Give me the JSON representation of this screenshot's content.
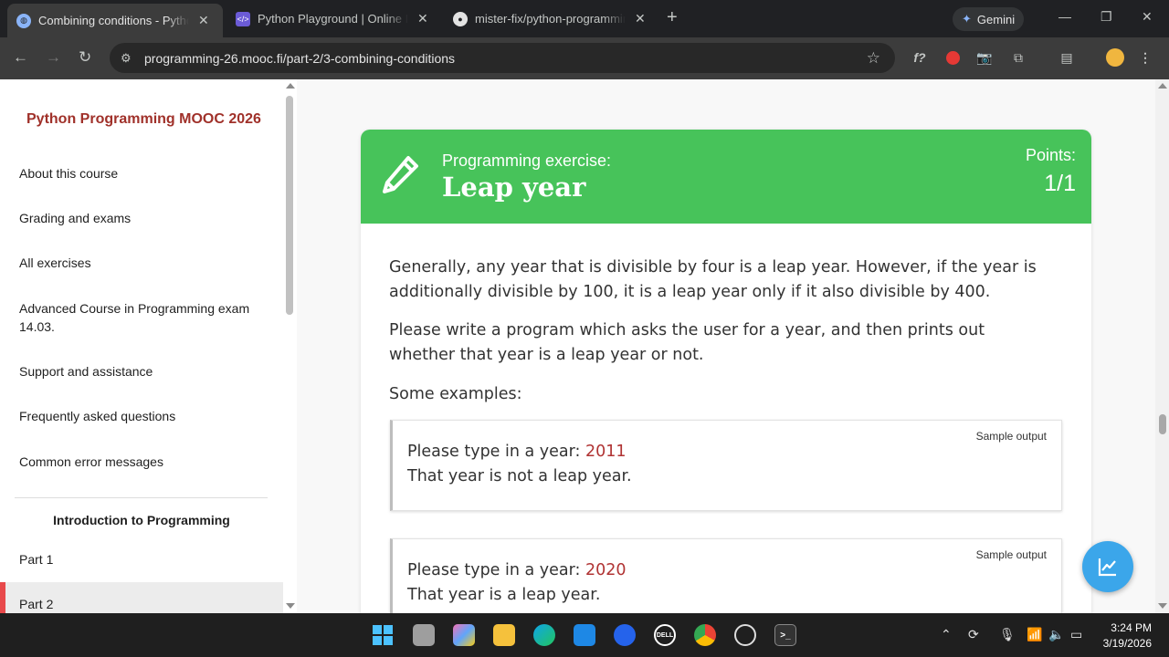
{
  "browser": {
    "tabs": [
      {
        "title": "Combining conditions - Python",
        "active": true,
        "favicon": "globe-icon"
      },
      {
        "title": "Python Playground | Online IDE",
        "active": false,
        "favicon": "code-icon"
      },
      {
        "title": "mister-fix/python-programming",
        "active": false,
        "favicon": "github-icon"
      }
    ],
    "gemini_label": "Gemini",
    "url": "programming-26.mooc.fi/part-2/3-combining-conditions",
    "ext_formula": "f?"
  },
  "sidebar": {
    "title": "Python Programming MOOC 2026",
    "items": [
      "About this course",
      "Grading and exams",
      "All exercises",
      "Advanced Course in Programming exam 14.03.",
      "Support and assistance",
      "Frequently asked questions",
      "Common error messages"
    ],
    "section_title": "Introduction to Programming",
    "parts": [
      "Part 1",
      "Part 2"
    ],
    "active_part": "Part 2"
  },
  "exercise": {
    "label": "Programming exercise:",
    "title": "Leap year",
    "points_label": "Points:",
    "points_value": "1/1",
    "paragraphs": [
      "Generally, any year that is divisible by four is a leap year. However, if the year is additionally divisible by 100, it is a leap year only if it also divisible by 400.",
      "Please write a program which asks the user for a year, and then prints out whether that year is a leap year or not.",
      "Some examples:"
    ],
    "samples": [
      {
        "label": "Sample output",
        "prompt": "Please type in a year: ",
        "input": "2011",
        "result": "That year is not a leap year."
      },
      {
        "label": "Sample output",
        "prompt": "Please type in a year: ",
        "input": "2020",
        "result": "That year is a leap year."
      }
    ]
  },
  "taskbar": {
    "time": "3:24 PM",
    "date": "3/19/2026",
    "dell_label": "DELL"
  },
  "colors": {
    "accent_green": "#47c35a",
    "sidebar_title": "#a0312a",
    "input_red": "#b03333",
    "fab_blue": "#3ba6ea",
    "active_bar": "#e8494b"
  }
}
